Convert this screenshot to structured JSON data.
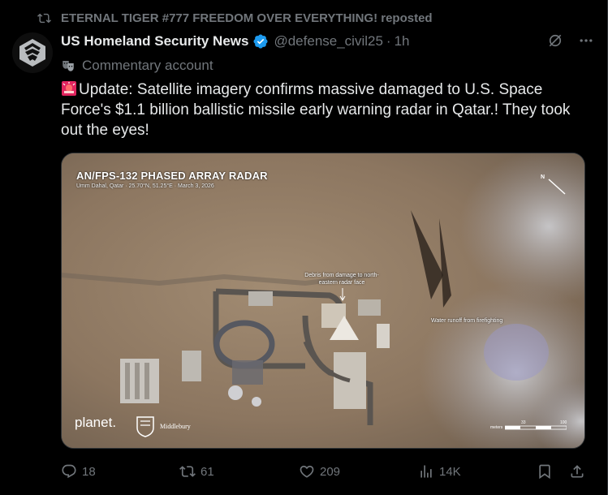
{
  "repost": {
    "text": "ETERNAL TIGER #777 FREEDOM OVER EVERYTHING! reposted",
    "icon": "repost-icon"
  },
  "author": {
    "name": "US Homeland Security News",
    "verified": true,
    "handle": "@defense_civil25",
    "separator": "·",
    "time": "1h",
    "label": "Commentary account",
    "label_icon": "commentary-mask-icon"
  },
  "tweet": {
    "emoji": "rotating-light-emoji",
    "text": "Update: Satellite imagery confirms massive damaged to U.S. Space Force's $1.1 billion ballistic missile early warning radar in Qatar.! They took out the eyes!"
  },
  "media": {
    "title": "AN/FPS-132 PHASED ARRAY RADAR",
    "subtitle": "Umm Dahal, Qatar · 25.70°N, 51.25°E · March 3, 2026",
    "north": "N",
    "annotation_debris": "Debris from damage to north-eastern radar face",
    "annotation_water": "Water runoff from firefighting",
    "credit_planet": "planet.",
    "credit_middlebury": "Middlebury",
    "scale_label": "meters",
    "scale_mid": "33",
    "scale_end": "100"
  },
  "actions": {
    "replies": "18",
    "reposts": "61",
    "likes": "209",
    "views": "14K"
  },
  "colors": {
    "background": "#000000",
    "text": "#e7e9ea",
    "muted": "#71767b",
    "verified": "#1d9bf0"
  }
}
